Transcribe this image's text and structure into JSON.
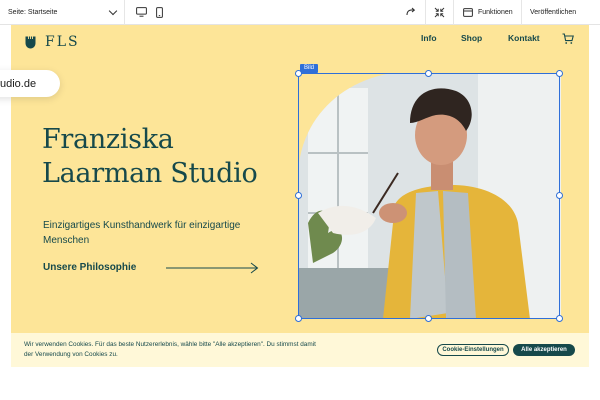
{
  "editor": {
    "page_select": "Seite: Startseite",
    "functions_label": "Funktionen",
    "publish_label": "Veröffentlichen",
    "icons": [
      "desktop-icon",
      "mobile-icon",
      "redo-icon",
      "collapse-icon",
      "functions-icon"
    ]
  },
  "site": {
    "logo_text": "FLS",
    "nav": [
      "Info",
      "Shop",
      "Kontakt"
    ],
    "title_line1": "Franziska",
    "title_line2": "Laarman Studio",
    "subtitle": "Einzigartiges Kunsthandwerk für einzigartige Menschen",
    "cta": "Unsere Philosophie",
    "selection_badge": "Bild",
    "colors": {
      "background": "#fde598",
      "primary": "#16494b",
      "selection": "#2f6fd8"
    }
  },
  "cookie": {
    "text": "Wir verwenden Cookies. Für das beste Nutzererlebnis, wähle bitte \"Alle akzeptieren\". Du stimmst damit der Verwendung von Cookies zu.",
    "settings_button": "Cookie-Einstellungen",
    "accept_button": "Alle akzeptieren"
  },
  "url_fragment": "udio.de"
}
